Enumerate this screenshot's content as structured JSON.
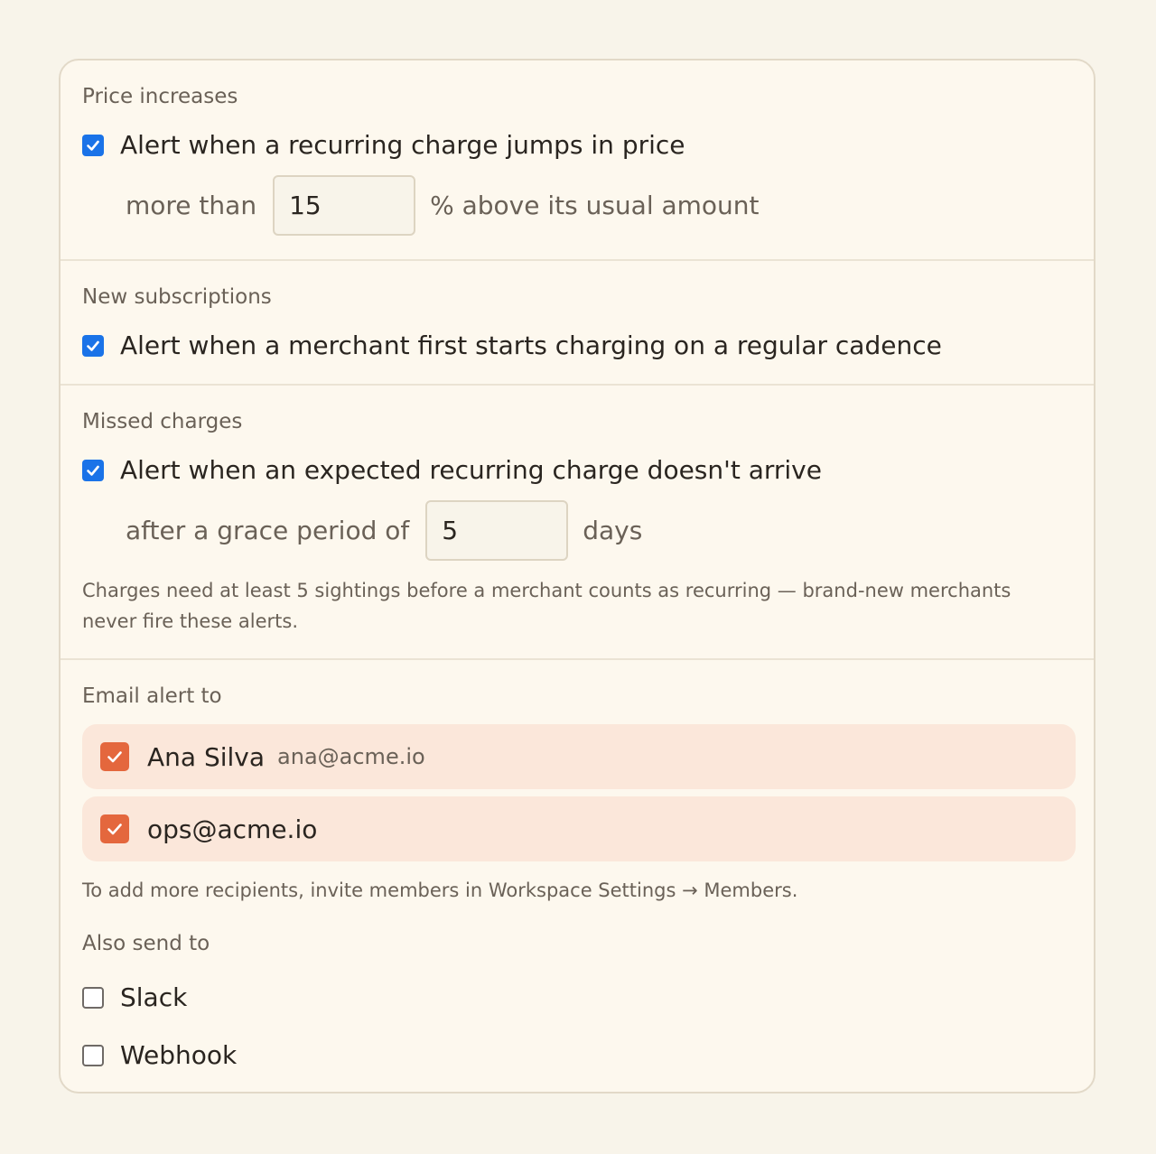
{
  "price_increases": {
    "title": "Price increases",
    "checkbox_label": "Alert when a recurring charge jumps in price",
    "checked": true,
    "prefix": "more than",
    "value": "15",
    "suffix": "% above its usual amount"
  },
  "new_subscriptions": {
    "title": "New subscriptions",
    "checkbox_label": "Alert when a merchant first starts charging on a regular cadence",
    "checked": true
  },
  "missed_charges": {
    "title": "Missed charges",
    "checkbox_label": "Alert when an expected recurring charge doesn't arrive",
    "checked": true,
    "prefix": "after a grace period of",
    "value": "5",
    "suffix": "days",
    "help": "Charges need at least 5 sightings before a merchant counts as recurring — brand-new merchants never fire these alerts."
  },
  "email_alert": {
    "title": "Email alert to",
    "recipients": [
      {
        "name": "Ana Silva",
        "email": "ana@acme.io",
        "checked": true
      },
      {
        "name": "ops@acme.io",
        "email": "",
        "checked": true
      }
    ],
    "help": "To add more recipients, invite members in Workspace Settings → Members."
  },
  "also_send": {
    "title": "Also send to",
    "options": [
      {
        "label": "Slack",
        "checked": false
      },
      {
        "label": "Webhook",
        "checked": false
      }
    ]
  },
  "colors": {
    "accent_blue": "#1a73e8",
    "accent_orange": "#e4673d",
    "recipient_bg": "#fbe7da",
    "page_bg": "#f8f4ea",
    "card_bg": "#fdf8ee"
  },
  "icons": {
    "check": "checkmark-icon"
  }
}
